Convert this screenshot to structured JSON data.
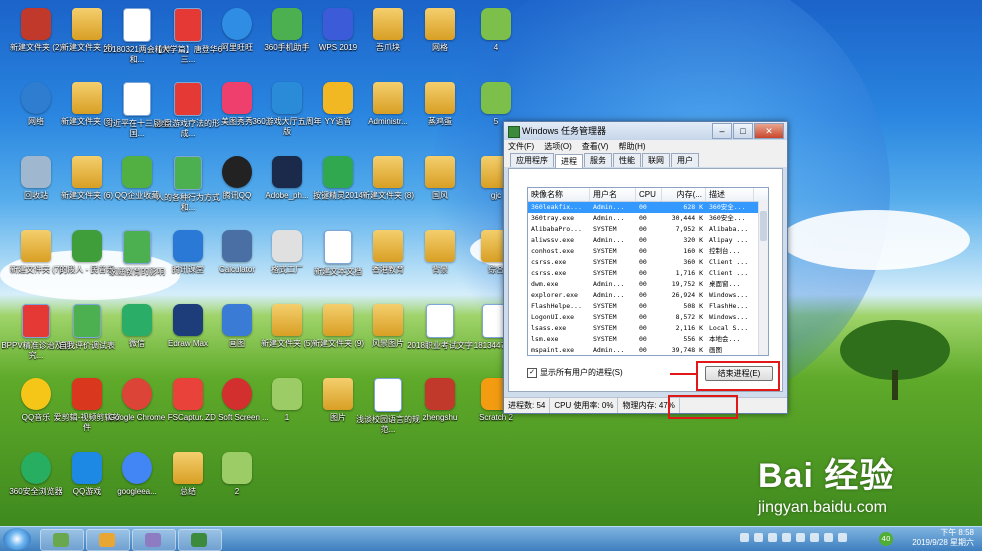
{
  "desktop_icons": [
    {
      "label": "新建文件夹 (2)",
      "kind": "app",
      "color": "#c0392b"
    },
    {
      "label": "新建文件夹 (4)",
      "kind": "folder",
      "color": ""
    },
    {
      "label": "20180321两会精神和...",
      "kind": "doc",
      "color": ""
    },
    {
      "label": "【大学篇】唐登华6三...",
      "kind": "doc",
      "color": "#e53935"
    },
    {
      "label": "阿里旺旺",
      "kind": "round",
      "color": "#2f8de4"
    },
    {
      "label": "360手机助手",
      "kind": "app",
      "color": "#4caf50"
    },
    {
      "label": "WPS 2019",
      "kind": "app",
      "color": "#3c5bd8"
    },
    {
      "label": "吾爪块",
      "kind": "folder",
      "color": ""
    },
    {
      "label": "网格",
      "kind": "folder",
      "color": ""
    },
    {
      "label": "4",
      "kind": "app",
      "color": "#7cbf4a"
    },
    {
      "label": "网络",
      "kind": "round",
      "color": "#2e7dd1"
    },
    {
      "label": "新建文件夹 (3)",
      "kind": "folder",
      "color": ""
    },
    {
      "label": "习近平在十三届全国...",
      "kind": "doc",
      "color": ""
    },
    {
      "label": "沙盘游戏疗法的形成...",
      "kind": "doc",
      "color": "#e53935"
    },
    {
      "label": "美图秀秀",
      "kind": "app",
      "color": "#ef3f6c"
    },
    {
      "label": "360游戏大厅五周年版",
      "kind": "app",
      "color": "#2a8bd8"
    },
    {
      "label": "YY语音",
      "kind": "app",
      "color": "#f2b824"
    },
    {
      "label": "Administr...",
      "kind": "folder",
      "color": ""
    },
    {
      "label": "蒸鸡蛋",
      "kind": "folder",
      "color": ""
    },
    {
      "label": "5",
      "kind": "app",
      "color": "#7cbf4a"
    },
    {
      "label": "回收站",
      "kind": "app",
      "color": "#9fb7cf"
    },
    {
      "label": "新建文件夹 (6)",
      "kind": "folder",
      "color": ""
    },
    {
      "label": "QQ企业收藏",
      "kind": "app",
      "color": "#52b043"
    },
    {
      "label": "人的各种行为方式和...",
      "kind": "doc",
      "color": "#4caf50"
    },
    {
      "label": "腾讯QQ",
      "kind": "round",
      "color": "#222222"
    },
    {
      "label": "Adobe_ph...",
      "kind": "app",
      "color": "#1b2a4a"
    },
    {
      "label": "按键精灵2014",
      "kind": "app",
      "color": "#2fa84f"
    },
    {
      "label": "新建文件夹 (8)",
      "kind": "folder",
      "color": ""
    },
    {
      "label": "国风",
      "kind": "folder",
      "color": ""
    },
    {
      "label": "gjc",
      "kind": "folder",
      "color": ""
    },
    {
      "label": "新建文件夹 (7)",
      "kind": "folder",
      "color": ""
    },
    {
      "label": "的段人 - 民音乐",
      "kind": "app",
      "color": "#3f9e3a"
    },
    {
      "label": "家庭教育的影响",
      "kind": "doc",
      "color": "#4caf50"
    },
    {
      "label": "腾讯课堂",
      "kind": "app",
      "color": "#2a79d6"
    },
    {
      "label": "Calculator",
      "kind": "app",
      "color": "#4a6fa5"
    },
    {
      "label": "格式工厂",
      "kind": "app",
      "color": "#e0e0e0"
    },
    {
      "label": "新建文本文档",
      "kind": "doc",
      "color": ""
    },
    {
      "label": "香港教育",
      "kind": "folder",
      "color": ""
    },
    {
      "label": "背景",
      "kind": "folder",
      "color": ""
    },
    {
      "label": "综合",
      "kind": "folder",
      "color": ""
    },
    {
      "label": "BPPV精准诊治及研究...",
      "kind": "doc",
      "color": "#e53935"
    },
    {
      "label": "自我评价调试表",
      "kind": "doc",
      "color": "#4caf50"
    },
    {
      "label": "微信",
      "kind": "app",
      "color": "#2aae67"
    },
    {
      "label": "Edraw Max",
      "kind": "app",
      "color": "#1d3d7a"
    },
    {
      "label": "画图",
      "kind": "app",
      "color": "#3a7bd5"
    },
    {
      "label": "新建文件夹 (5)",
      "kind": "folder",
      "color": ""
    },
    {
      "label": "新建文件夹 (9)",
      "kind": "folder",
      "color": ""
    },
    {
      "label": "风景图片",
      "kind": "folder",
      "color": ""
    },
    {
      "label": "2018职业考试文字",
      "kind": "doc",
      "color": ""
    },
    {
      "label": "1813447528",
      "kind": "doc",
      "color": ""
    },
    {
      "label": "QQ音乐",
      "kind": "round",
      "color": "#f5c518"
    },
    {
      "label": "爱剪辑-视频剪辑软件",
      "kind": "app",
      "color": "#d9381e"
    },
    {
      "label": "Google Chrome",
      "kind": "round",
      "color": "#db4437"
    },
    {
      "label": "FSCaptur...",
      "kind": "app",
      "color": "#e8423a"
    },
    {
      "label": "ZD Soft Screen ...",
      "kind": "round",
      "color": "#d32f2f"
    },
    {
      "label": "1",
      "kind": "app",
      "color": "#9ccc65"
    },
    {
      "label": "图片",
      "kind": "folder",
      "color": ""
    },
    {
      "label": "浅谈校园语言的规范...",
      "kind": "doc",
      "color": ""
    },
    {
      "label": "zhengshu",
      "kind": "app",
      "color": "#c0392b"
    },
    {
      "label": "Scratch 2",
      "kind": "app",
      "color": "#f39c12"
    },
    {
      "label": "360安全浏览器",
      "kind": "round",
      "color": "#27ae60"
    },
    {
      "label": "QQ游戏",
      "kind": "app",
      "color": "#1e88e5"
    },
    {
      "label": "googleea...",
      "kind": "round",
      "color": "#4285f4"
    },
    {
      "label": "总结",
      "kind": "folder",
      "color": ""
    },
    {
      "label": "2",
      "kind": "app",
      "color": "#9ccc65"
    }
  ],
  "task_manager": {
    "title": "Windows 任务管理器",
    "menu": [
      "文件(F)",
      "选项(O)",
      "查看(V)",
      "帮助(H)"
    ],
    "tabs": [
      "应用程序",
      "进程",
      "服务",
      "性能",
      "联网",
      "用户"
    ],
    "active_tab": "进程",
    "columns": [
      "映像名称",
      "用户名",
      "CPU",
      "内存(...",
      "描述"
    ],
    "processes": [
      [
        "360leakfix...",
        "Admin...",
        "00",
        "628 K",
        "360安全..."
      ],
      [
        "360tray.exe",
        "Admin...",
        "00",
        "30,444 K",
        "360安全..."
      ],
      [
        "AlibabaPro...",
        "SYSTEM",
        "00",
        "7,952 K",
        "Alibaba..."
      ],
      [
        "aliwssv.exe",
        "Admin...",
        "00",
        "320 K",
        "Alipay ..."
      ],
      [
        "conhost.exe",
        "SYSTEM",
        "00",
        "160 K",
        "控制台..."
      ],
      [
        "csrss.exe",
        "SYSTEM",
        "00",
        "360 K",
        "Client ..."
      ],
      [
        "csrss.exe",
        "SYSTEM",
        "00",
        "1,716 K",
        "Client ..."
      ],
      [
        "dwm.exe",
        "Admin...",
        "00",
        "19,752 K",
        "桌面窗..."
      ],
      [
        "explorer.exe",
        "Admin...",
        "00",
        "26,924 K",
        "Windows..."
      ],
      [
        "FlashHelpe...",
        "SYSTEM",
        "00",
        "508 K",
        "FlashHe..."
      ],
      [
        "LogonUI.exe",
        "SYSTEM",
        "00",
        "8,572 K",
        "Windows..."
      ],
      [
        "lsass.exe",
        "SYSTEM",
        "00",
        "2,116 K",
        "Local S..."
      ],
      [
        "lsm.exe",
        "SYSTEM",
        "00",
        "556 K",
        "本地会..."
      ],
      [
        "mspaint.exe",
        "Admin...",
        "00",
        "39,748 K",
        "画图"
      ]
    ],
    "show_all_label": "显示所有用户的进程(S)",
    "end_process_label": "结束进程(E)",
    "status_processes": "进程数: 54",
    "status_cpu": "CPU 使用率: 0%",
    "status_memory": "物理内存: 47%"
  },
  "taskbar": {
    "clock_time": "下午 8:58",
    "clock_date": "2019/9/28 星期六",
    "badge": "40"
  },
  "watermark": {
    "brand": "Bai 经验",
    "url": "jingyan.baidu.com"
  },
  "colors": {
    "highlight_red": "#e01818",
    "selection_blue": "#3399ff"
  }
}
